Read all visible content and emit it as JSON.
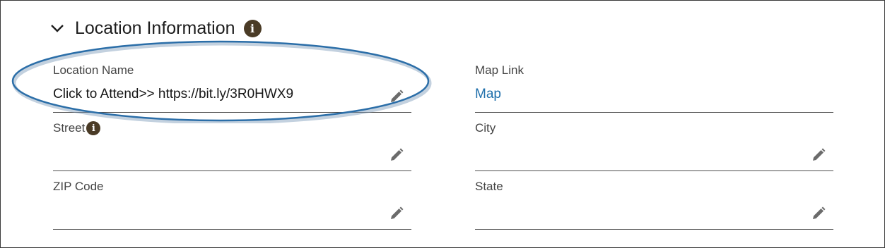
{
  "section": {
    "title": "Location Information",
    "info_glyph": "i",
    "icon": "chevron-down-icon"
  },
  "fields": {
    "location_name": {
      "label": "Location Name",
      "value": "Click to Attend>> https://bit.ly/3R0HWX9"
    },
    "map_link": {
      "label": "Map Link",
      "value": "Map"
    },
    "street": {
      "label": "Street",
      "value": "",
      "info_glyph": "i"
    },
    "city": {
      "label": "City",
      "value": ""
    },
    "zip_code": {
      "label": "ZIP Code",
      "value": ""
    },
    "state": {
      "label": "State",
      "value": ""
    }
  },
  "colors": {
    "accent_link": "#1f6fab",
    "info_badge": "#4a3b26",
    "highlight_oval": "#2b6ea8"
  }
}
